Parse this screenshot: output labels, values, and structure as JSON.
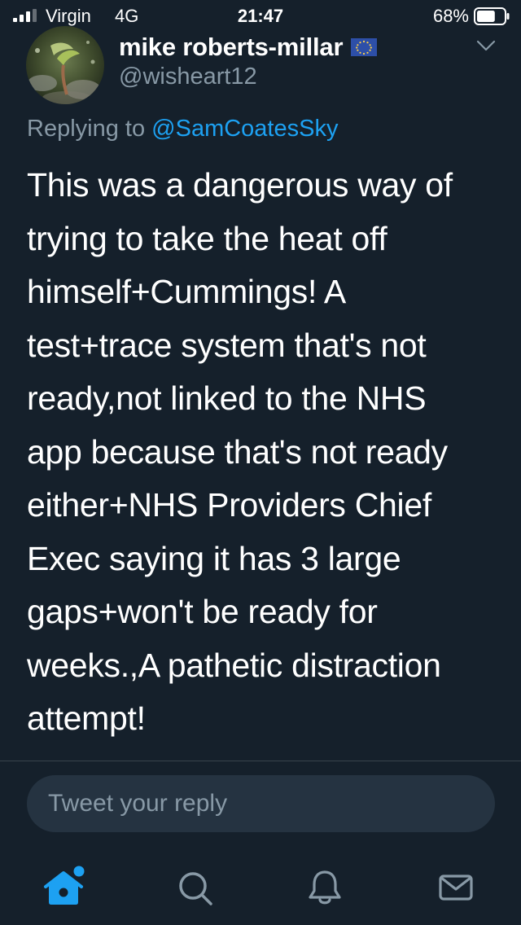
{
  "status_bar": {
    "carrier": "Virgin",
    "network": "4G",
    "time": "21:47",
    "battery_percent": "68%",
    "battery_level": 0.68
  },
  "tweet": {
    "display_name": "mike roberts-millar",
    "handle": "@wisheart12",
    "replying_prefix": "Replying to ",
    "replying_to": "@SamCoatesSky",
    "text": "This was a dangerous way of\ntrying to take the heat off\nhimself+Cummings! A\ntest+trace system that's not\nready,not linked to the NHS\napp because that's not ready\neither+NHS Providers Chief\nExec saying it has 3 large\ngaps+won't be ready for\nweeks.,A pathetic distraction\nattempt!"
  },
  "reply": {
    "placeholder": "Tweet your reply"
  },
  "tabs": [
    {
      "icon": "home-icon",
      "active": true,
      "notification_dot": true
    },
    {
      "icon": "search-icon",
      "active": false
    },
    {
      "icon": "notifications-icon",
      "active": false
    },
    {
      "icon": "messages-icon",
      "active": false
    }
  ],
  "colors": {
    "background": "#15202b",
    "accent": "#1da1f2",
    "secondary_text": "#8899a6",
    "input_background": "#253341",
    "divider": "#38444d"
  }
}
